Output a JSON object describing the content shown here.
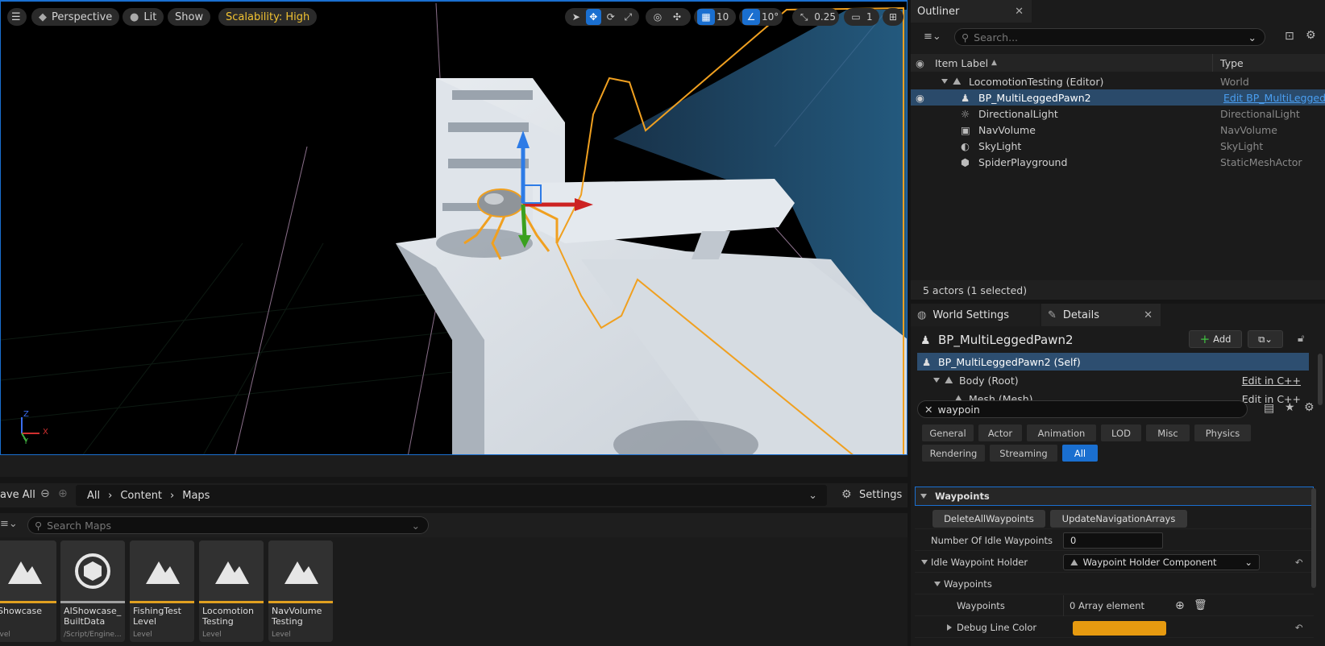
{
  "viewport": {
    "perspective_label": "Perspective",
    "lit_label": "Lit",
    "show_label": "Show",
    "scalability_label": "Scalability: High",
    "grid_snap": "10",
    "rotate_snap": "10°",
    "scale_snap": "0.25",
    "camera_speed": "1",
    "axis_z": "Z",
    "axis_x": "X",
    "axis_y": "Y"
  },
  "content_browser": {
    "save_all_label": "ave All",
    "breadcrumb": [
      "All",
      "Content",
      "Maps"
    ],
    "settings_label": "Settings",
    "search_placeholder": "Search Maps",
    "assets": [
      {
        "name": "lShowcase",
        "kind": "evel",
        "type": "level"
      },
      {
        "name": "AIShowcase_ BuiltData",
        "kind": "/Script/Engine...",
        "type": "builtdata"
      },
      {
        "name": "FishingTest Level",
        "kind": "Level",
        "type": "level"
      },
      {
        "name": "Locomotion Testing",
        "kind": "Level",
        "type": "level"
      },
      {
        "name": "NavVolume Testing",
        "kind": "Level",
        "type": "level"
      }
    ]
  },
  "outliner": {
    "title": "Outliner",
    "search_placeholder": "Search...",
    "col_label": "Item Label",
    "col_type": "Type",
    "world": {
      "label": "LocomotionTesting (Editor)",
      "type": "World"
    },
    "items": [
      {
        "label": "BP_MultiLeggedPawn2",
        "type": "Edit BP_MultiLeggedPa",
        "icon": "pawn-icon"
      },
      {
        "label": "DirectionalLight",
        "type": "DirectionalLight",
        "icon": "sun-icon"
      },
      {
        "label": "NavVolume",
        "type": "NavVolume",
        "icon": "volume-icon"
      },
      {
        "label": "SkyLight",
        "type": "SkyLight",
        "icon": "skylight-icon"
      },
      {
        "label": "SpiderPlayground",
        "type": "StaticMeshActor",
        "icon": "mesh-icon"
      }
    ],
    "status": "5 actors (1 selected)"
  },
  "details": {
    "tab_world": "World Settings",
    "tab_details": "Details",
    "actor_name": "BP_MultiLeggedPawn2",
    "add_label": "Add",
    "components": [
      {
        "label": "BP_MultiLeggedPawn2 (Self)",
        "action": ""
      },
      {
        "label": "Body (Root)",
        "action": "Edit in C++"
      },
      {
        "label": "Mesh (Mesh)",
        "action": "Edit in C++"
      }
    ],
    "filter_value": "waypoin",
    "categories_row1": [
      "General",
      "Actor",
      "Animation",
      "LOD",
      "Misc",
      "Physics"
    ],
    "categories_row2": [
      "Rendering",
      "Streaming",
      "All"
    ],
    "section_waypoints": "Waypoints",
    "btn_delete": "DeleteAllWaypoints",
    "btn_update": "UpdateNavigationArrays",
    "num_idle_label": "Number Of Idle Waypoints",
    "num_idle_value": "0",
    "idle_holder_label": "Idle Waypoint Holder",
    "idle_holder_value": "Waypoint Holder Component",
    "sub_waypoints": "Waypoints",
    "waypoints_label": "Waypoints",
    "waypoints_value": "0 Array element",
    "debug_color_label": "Debug Line Color",
    "debug_color": "#e69a10"
  }
}
